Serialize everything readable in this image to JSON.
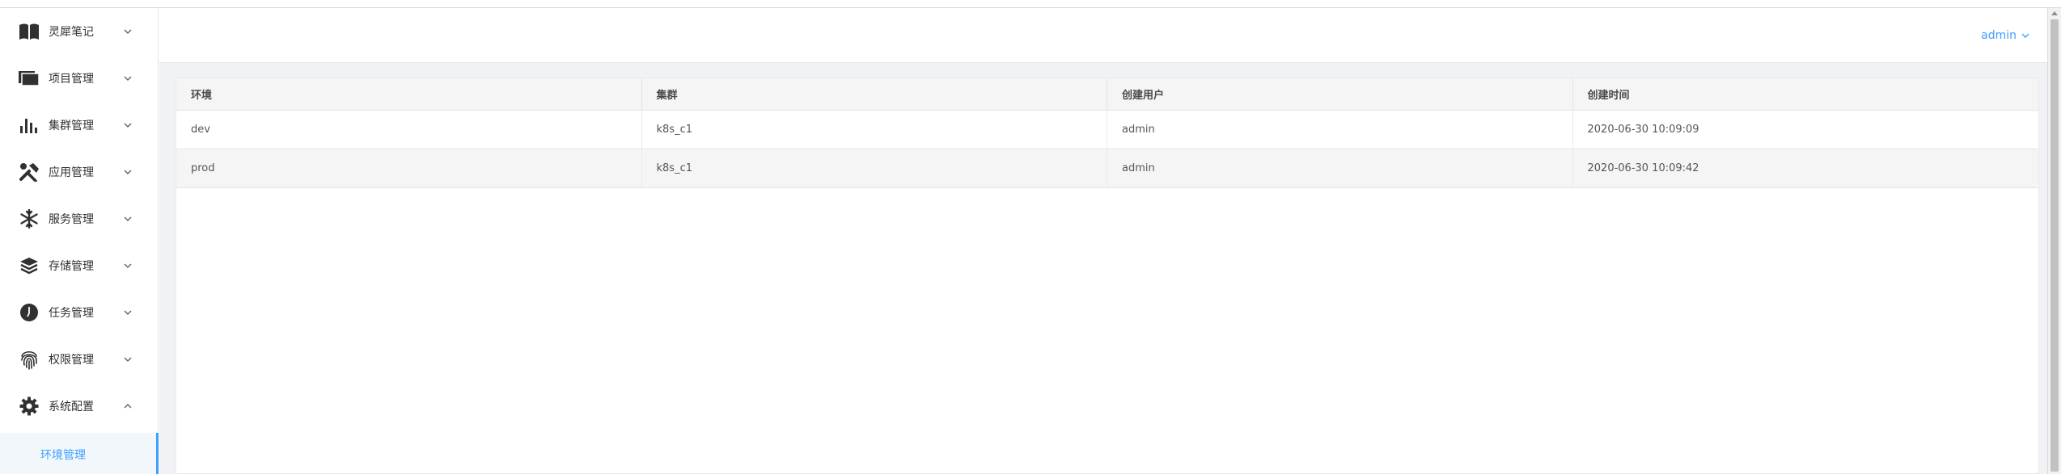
{
  "sidebar": {
    "items": [
      {
        "label": "灵犀笔记",
        "icon": "book-icon"
      },
      {
        "label": "项目管理",
        "icon": "folder-icon"
      },
      {
        "label": "集群管理",
        "icon": "bar-chart-icon"
      },
      {
        "label": "应用管理",
        "icon": "tools-icon"
      },
      {
        "label": "服务管理",
        "icon": "snowflake-icon"
      },
      {
        "label": "存储管理",
        "icon": "layers-icon"
      },
      {
        "label": "任务管理",
        "icon": "clock-icon"
      },
      {
        "label": "权限管理",
        "icon": "fingerprint-icon"
      },
      {
        "label": "系统配置",
        "icon": "gear-icon"
      }
    ],
    "active_subitem": "环境管理"
  },
  "header": {
    "user": "admin"
  },
  "table": {
    "columns": [
      "环境",
      "集群",
      "创建用户",
      "创建时间"
    ],
    "rows": [
      [
        "dev",
        "k8s_c1",
        "admin",
        "2020-06-30 10:09:09"
      ],
      [
        "prod",
        "k8s_c1",
        "admin",
        "2020-06-30 10:09:42"
      ]
    ]
  },
  "colors": {
    "accent": "#409eff",
    "content_bg": "#f0f2f5",
    "header_row_bg": "#f5f5f5",
    "icon": "#303133"
  }
}
